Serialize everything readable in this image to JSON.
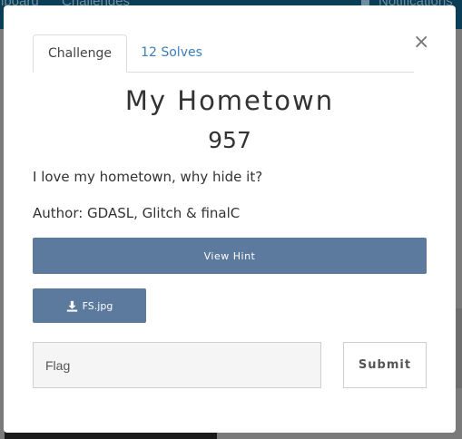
{
  "background": {
    "nav": {
      "dashboard": "hboard",
      "challenges": "Challenges",
      "notifications": "Notifications"
    }
  },
  "modal": {
    "tabs": [
      {
        "label": "Challenge",
        "active": true
      },
      {
        "label": "12 Solves",
        "active": false
      }
    ],
    "close_label": "×",
    "challenge": {
      "name": "My Hometown",
      "value": "957",
      "description": "I love my hometown, why hide it?",
      "author": "Author: GDASL, Glitch & finalC"
    },
    "hint_button": "View Hint",
    "file": {
      "icon": "download-icon",
      "name": "FS.jpg"
    },
    "flag_input": {
      "placeholder": "Flag",
      "value": ""
    },
    "submit_label": "Submit"
  },
  "colors": {
    "button_blue": "#5b7a9d",
    "link_blue": "#3c7db8",
    "navbar": "#0a3d56"
  }
}
